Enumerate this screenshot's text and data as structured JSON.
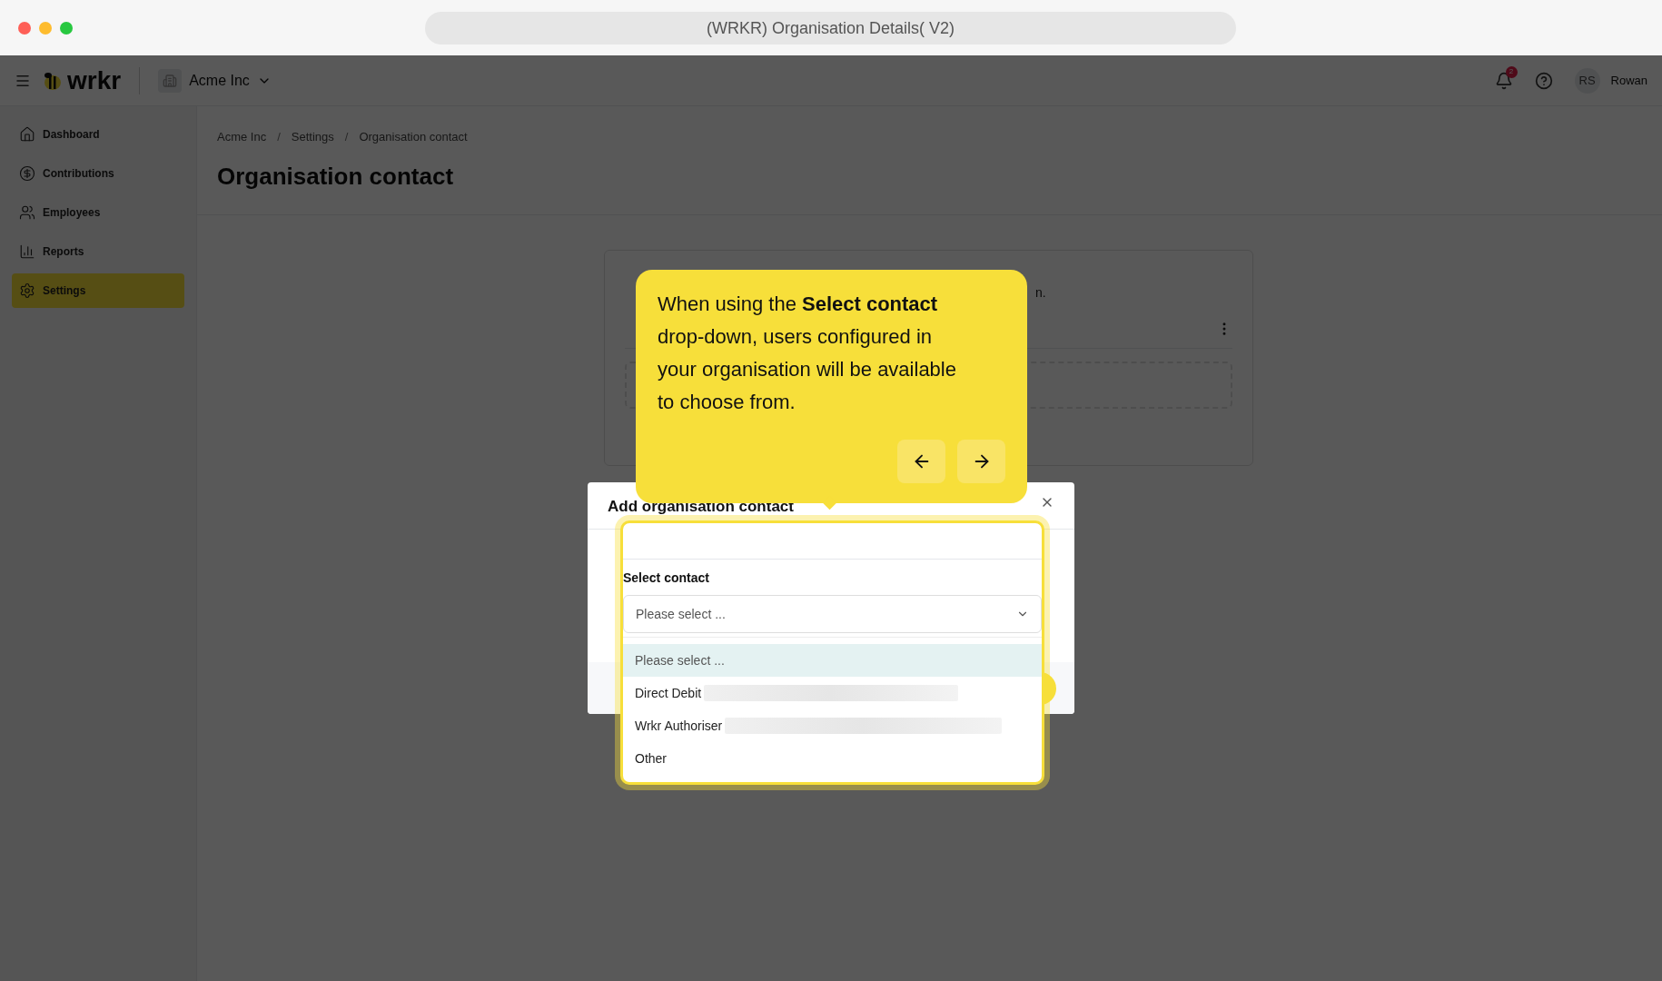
{
  "browser": {
    "title": "(WRKR) Organisation Details( V2)"
  },
  "header": {
    "logo": "wrkr",
    "organisation": "Acme Inc",
    "notifications": "2",
    "avatar_initials": "RS",
    "user": "Rowan"
  },
  "sidebar": {
    "items": [
      {
        "label": "Dashboard",
        "kind": "home",
        "selected": false
      },
      {
        "label": "Contributions",
        "kind": "dollar",
        "selected": false
      },
      {
        "label": "Employees",
        "kind": "people",
        "selected": false
      },
      {
        "label": "Reports",
        "kind": "chart",
        "selected": false
      },
      {
        "label": "Settings",
        "kind": "gear",
        "selected": true
      }
    ]
  },
  "breadcrumbs": {
    "items": [
      "Acme Inc",
      "Settings",
      "Organisation contact"
    ],
    "separators": [
      "/",
      "/"
    ]
  },
  "page_title": "Organisation contact",
  "card": {
    "text": "n."
  },
  "modal": {
    "title": "Add organisation contact",
    "field_label": "Select contact",
    "select": {
      "placeholder": "Please select ..."
    },
    "options": [
      {
        "label": "Please select ...",
        "selected": true,
        "redacted": false
      },
      {
        "label": "Direct Debit",
        "selected": false,
        "redacted": true
      },
      {
        "label": "Wrkr Authoriser",
        "selected": false,
        "redacted": true
      },
      {
        "label": "Other",
        "selected": false,
        "redacted": false
      }
    ]
  },
  "tour": {
    "text": "When using the **Select contact** drop-down, users configured in your organisation will be available to choose from."
  }
}
